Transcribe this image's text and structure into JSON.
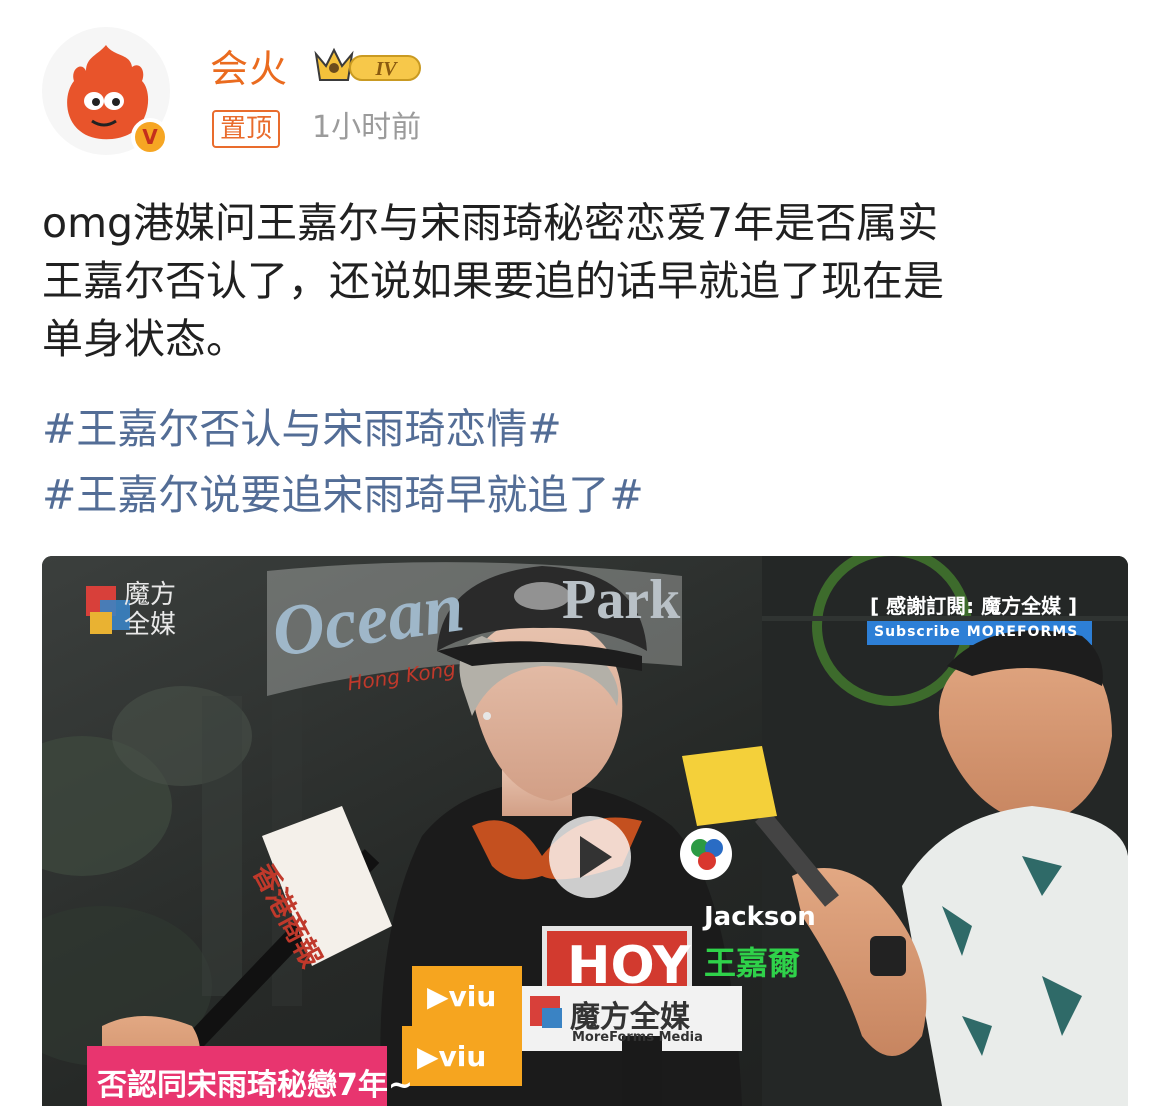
{
  "user": {
    "name": "会火",
    "level": "IV",
    "verified_badge": "V",
    "pinned_label": "置顶",
    "time": "1小时前"
  },
  "post": {
    "lines": [
      "omg港媒问王嘉尔与宋雨琦秘密恋爱7年是否属实",
      "王嘉尔否认了，还说如果要追的话早就追了现在是",
      "单身状态。"
    ],
    "hashtags": [
      "#王嘉尔否认与宋雨琦恋情#",
      "#王嘉尔说要追宋雨琦早就追了#"
    ]
  },
  "video": {
    "logo_top": "魔方",
    "logo_bottom": "全媒",
    "sign_ocean": "Ocean",
    "sign_park": "Park",
    "sign_hk": "Hong Kong",
    "subscribe_cn": "感謝訂閱: 魔方全媒",
    "subscribe_en": "Subscribe MOREFORMS",
    "mic_left": "香港商報",
    "speaker_en": "Jackson",
    "speaker_cn": "王嘉爾",
    "mic_hoy": "HOY",
    "mic_viu1": "viu",
    "mic_viu2": "viu",
    "mic_mf_cn": "魔方全媒",
    "mic_mf_en": "MoreForms Media",
    "caption": "否認同宋雨琦秘戀7年~"
  },
  "colors": {
    "username": "#ea6b1f",
    "hashtag": "#536d96",
    "body_text": "#202020",
    "time": "#9b9b9b",
    "pin_border": "#e96c2d"
  }
}
